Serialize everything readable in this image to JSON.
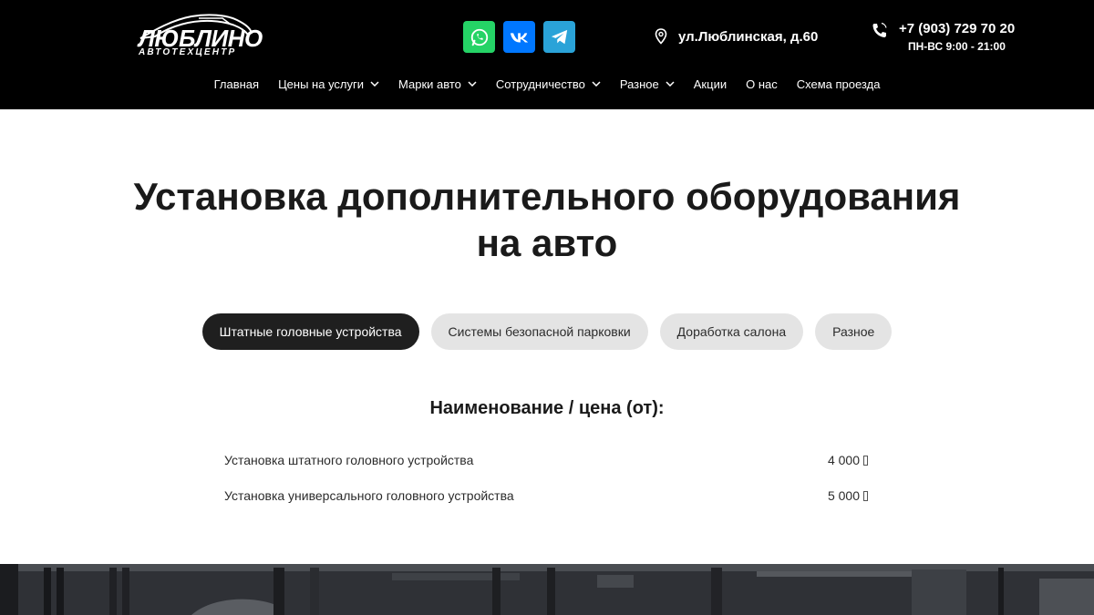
{
  "header": {
    "logo": {
      "main": "ЛЮБЛИНО",
      "sub": "АВТОТЕХЦЕНТР"
    },
    "social": [
      {
        "name": "whatsapp",
        "icon": "whatsapp-icon",
        "color": "#25d366"
      },
      {
        "name": "vk",
        "icon": "vk-icon",
        "color": "#0077ff"
      },
      {
        "name": "telegram",
        "icon": "telegram-icon",
        "color": "#2aa3d8"
      }
    ],
    "address": {
      "icon": "location-pin-icon",
      "text": "ул.Люблинская, д.60"
    },
    "phone": {
      "icon": "phone-icon",
      "number": "+7 (903) 729 70 20",
      "hours": "ПН-ВС 9:00 - 21:00"
    },
    "nav": [
      {
        "label": "Главная",
        "has_dropdown": false
      },
      {
        "label": "Цены на услуги",
        "has_dropdown": true
      },
      {
        "label": "Марки авто",
        "has_dropdown": true
      },
      {
        "label": "Сотрудничество",
        "has_dropdown": true
      },
      {
        "label": "Разное",
        "has_dropdown": true
      },
      {
        "label": "Акции",
        "has_dropdown": false
      },
      {
        "label": "О нас",
        "has_dropdown": false
      },
      {
        "label": "Схема проезда",
        "has_dropdown": false
      }
    ]
  },
  "main": {
    "title_line1": "Установка дополнительного оборудования",
    "title_line2": "на авто",
    "tabs": [
      {
        "label": "Штатные головные устройства",
        "active": true
      },
      {
        "label": "Системы безопасной парковки",
        "active": false
      },
      {
        "label": "Доработка салона",
        "active": false
      },
      {
        "label": "Разное",
        "active": false
      }
    ],
    "list_title": "Наименование / цена (от):",
    "rows": [
      {
        "name": "Установка штатного головного устройства",
        "price": "4 000"
      },
      {
        "name": "Установка универсального головного устройства",
        "price": "5 000"
      }
    ]
  },
  "colors": {
    "header_bg": "#000000",
    "active_tab": "#1f1f1f",
    "inactive_tab": "#e4e4e4"
  }
}
